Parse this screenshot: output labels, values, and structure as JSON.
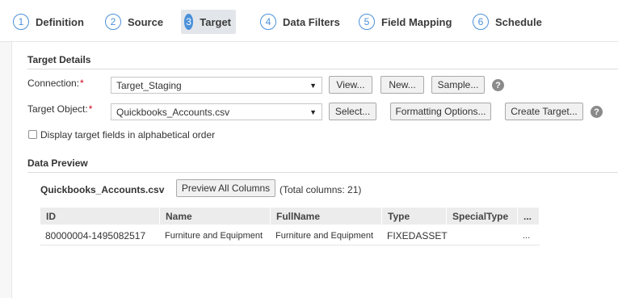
{
  "steps": [
    {
      "num": "1",
      "label": "Definition"
    },
    {
      "num": "2",
      "label": "Source"
    },
    {
      "num": "3",
      "label": "Target"
    },
    {
      "num": "4",
      "label": "Data Filters"
    },
    {
      "num": "5",
      "label": "Field Mapping"
    },
    {
      "num": "6",
      "label": "Schedule"
    }
  ],
  "active_step": "Target",
  "target_details": {
    "title": "Target Details",
    "connection_label": "Connection:",
    "connection_value": "Target_Staging",
    "target_object_label": "Target Object:",
    "target_object_value": "Quickbooks_Accounts.csv",
    "required_mark": "*",
    "buttons": {
      "view": "View...",
      "new": "New...",
      "sample": "Sample...",
      "select": "Select...",
      "formatting": "Formatting Options...",
      "create_target": "Create Target..."
    },
    "help_glyph": "?",
    "alpha_checkbox_label": "Display target fields in alphabetical order",
    "alpha_checked": false
  },
  "data_preview": {
    "title": "Data Preview",
    "file_name": "Quickbooks_Accounts.csv",
    "preview_all_button": "Preview All Columns",
    "total_columns_text": "(Total columns: 21)",
    "columns": [
      "ID",
      "Name",
      "FullName",
      "Type",
      "SpecialType",
      "..."
    ],
    "rows": [
      [
        "80000004-1495082517",
        "Furniture and Equipment",
        "Furniture and Equipment",
        "FIXEDASSET",
        "",
        "..."
      ]
    ]
  },
  "colors": {
    "accent": "#4a90d9",
    "required": "#d0021b"
  }
}
